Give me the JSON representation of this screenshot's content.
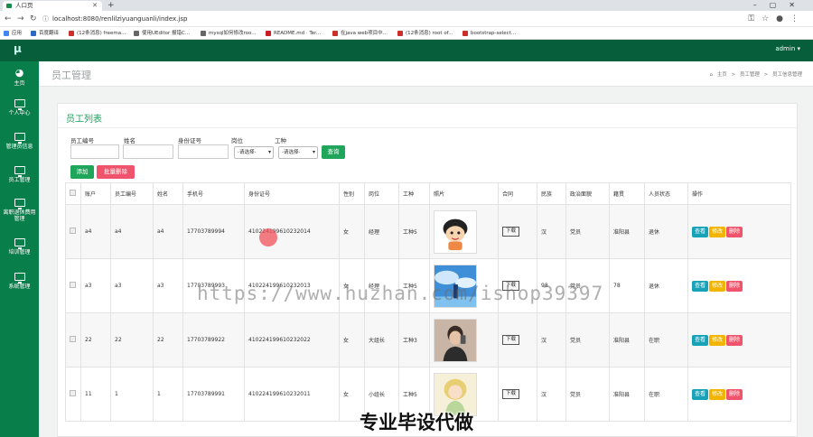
{
  "browser": {
    "tab_title": "人口页",
    "url": "localhost:8080/renlilziyuanguanli/index.jsp",
    "bookmarks": [
      {
        "label": "应用",
        "color": "#4285f4"
      },
      {
        "label": "百度翻译",
        "color": "#2d68c4"
      },
      {
        "label": "(12条消息) freema...",
        "color": "#c9302c"
      },
      {
        "label": "使用UEditor 报错C...",
        "color": "#666666"
      },
      {
        "label": "mysql如何修改roo...",
        "color": "#666666"
      },
      {
        "label": "README.md · Ter...",
        "color": "#c71d23"
      },
      {
        "label": "在java web项目中...",
        "color": "#c9302c"
      },
      {
        "label": "(12条消息) root of...",
        "color": "#c9302c"
      },
      {
        "label": "bootstrap-select...",
        "color": "#c9302c"
      }
    ]
  },
  "app": {
    "logo": "μ",
    "user": "admin ▾",
    "accent": "#087e4a"
  },
  "sidebar": {
    "items": [
      {
        "label": "主页"
      },
      {
        "label": "个人中心"
      },
      {
        "label": "管理员信息"
      },
      {
        "label": "员工管理"
      },
      {
        "label": "离职退休费用管理"
      },
      {
        "label": "培训管理"
      },
      {
        "label": "系统管理"
      }
    ]
  },
  "page": {
    "title": "员工管理",
    "breadcrumb": [
      "主页",
      ">",
      "员工管理",
      ">",
      "员工信息管理"
    ],
    "card_title": "员工列表"
  },
  "filters": {
    "labels": [
      "员工编号",
      "姓名",
      "身份证号",
      "岗位",
      "工种"
    ],
    "post_select": "-请选择-",
    "type_select": "-请选择-",
    "search_button": "查询",
    "add_button": "添加",
    "batch_delete_button": "批量删除"
  },
  "table": {
    "headers": [
      "账户",
      "员工编号",
      "姓名",
      "手机号",
      "身份证号",
      "性别",
      "岗位",
      "工种",
      "照片",
      "合同",
      "民族",
      "政治面貌",
      "籍贯",
      "人员状态",
      "操作"
    ],
    "download_label": "下载",
    "actions": {
      "view": "查看",
      "edit": "修改",
      "delete": "删除"
    },
    "rows": [
      {
        "account": "a4",
        "emp_no": "a4",
        "name": "a4",
        "phone": "17703789994",
        "id_card": "410224199610232014",
        "gender": "女",
        "post": "经理",
        "type": "工种5",
        "nation": "汉",
        "political": "党员",
        "origin": "准阳县",
        "status": "退休"
      },
      {
        "account": "a3",
        "emp_no": "a3",
        "name": "a3",
        "phone": "17703789993",
        "id_card": "410224199610232013",
        "gender": "女",
        "post": "经理",
        "type": "工种5",
        "nation": "98",
        "political": "党员",
        "origin": "78",
        "status": "退休"
      },
      {
        "account": "22",
        "emp_no": "22",
        "name": "22",
        "phone": "17703789922",
        "id_card": "410224199610232022",
        "gender": "女",
        "post": "大组长",
        "type": "工种3",
        "nation": "汉",
        "political": "党员",
        "origin": "准阳县",
        "status": "在职"
      },
      {
        "account": "11",
        "emp_no": "1",
        "name": "1",
        "phone": "17703789991",
        "id_card": "410224199610232011",
        "gender": "女",
        "post": "小组长",
        "type": "工种5",
        "nation": "汉",
        "political": "党员",
        "origin": "准阳县",
        "status": "在职"
      }
    ]
  },
  "overlay": {
    "watermark": "https://www.huzhan.com/ishop39397",
    "banner": "专业毕设代做"
  }
}
